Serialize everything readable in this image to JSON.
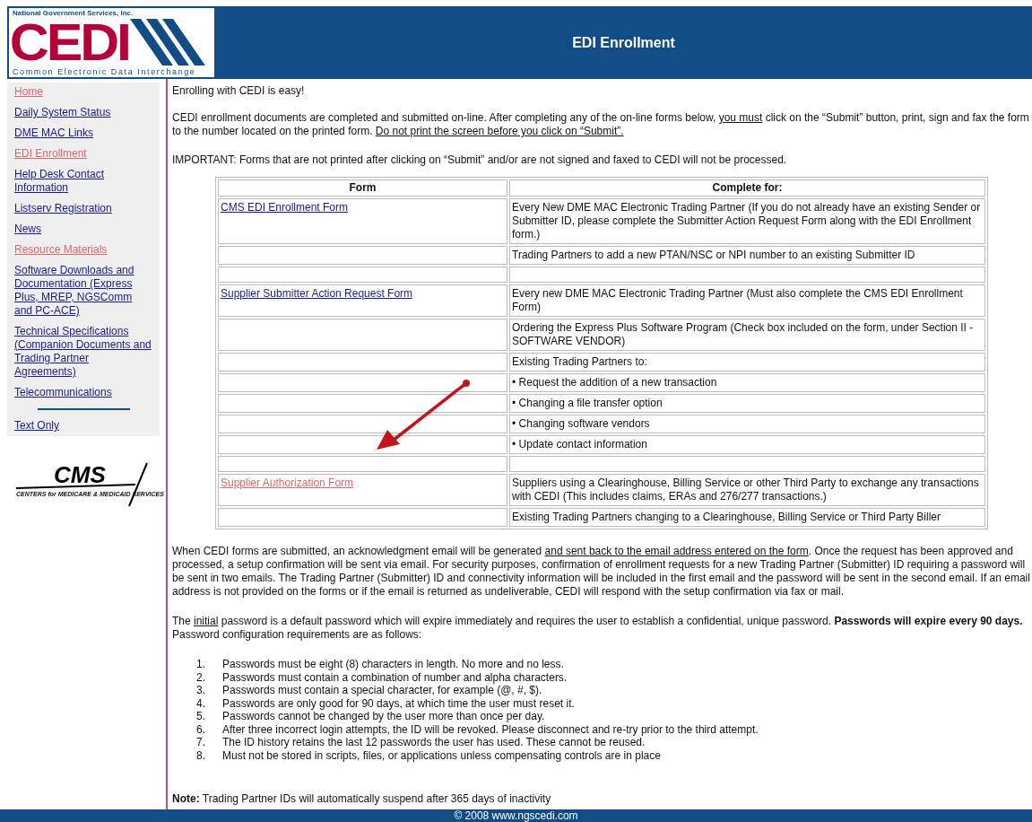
{
  "header": {
    "logo": {
      "org": "National Government Services, Inc.",
      "mark": "CEDI",
      "tagline": "Common Electronic Data Interchange"
    },
    "title": "EDI Enrollment"
  },
  "sidebar": {
    "items": [
      {
        "label": "Home",
        "visited": true
      },
      {
        "label": "Daily System Status",
        "visited": false
      },
      {
        "label": "DME MAC Links",
        "visited": false
      },
      {
        "label": "EDI Enrollment",
        "visited": true
      },
      {
        "label": "Help Desk Contact Information",
        "visited": false
      },
      {
        "label": "Listserv Registration",
        "visited": false
      },
      {
        "label": "News",
        "visited": false
      },
      {
        "label": "Resource Materials",
        "visited": true
      },
      {
        "label": "Software Downloads and Documentation (Express Plus, MREP, NGSComm and PC-ACE)",
        "visited": false
      },
      {
        "label": "Technical Specifications (Companion Documents and Trading Partner Agreements)",
        "visited": false
      },
      {
        "label": "Telecommunications",
        "visited": false
      }
    ],
    "footer_link": {
      "label": "Text Only",
      "visited": false
    },
    "cms_logo": {
      "mark": "CMS",
      "tagline": "CENTERS for MEDICARE & MEDICAID SERVICES"
    }
  },
  "intro": "Enrolling with CEDI is easy!",
  "instructions": [
    {
      "text": "CEDI enrollment documents are completed and submitted on-line. After completing any of the on-line forms below, ",
      "underline": false
    },
    {
      "text": "you must",
      "underline": true
    },
    {
      "text": " click on the “Submit” button, print, sign and fax the form to the number located on the printed form. ",
      "underline": false
    },
    {
      "text": "Do not print the screen before you click on “Submit”.",
      "underline": true
    }
  ],
  "important": "IMPORTANT: Forms that are not printed after clicking on “Submit” and/or are not signed and faxed to CEDI will not be processed.",
  "table": {
    "columns": [
      "Form",
      "Complete for:"
    ],
    "rows": [
      {
        "form": {
          "label": "CMS EDI Enrollment Form",
          "visited": false
        },
        "complete_for": "Every New DME MAC Electronic Trading Partner (If you do not already have an existing Sender or Submitter ID, please complete the Submitter Action Request Form along with the EDI Enrollment form.)"
      },
      {
        "complete_for": "Trading Partners to add a new PTAN/NSC or NPI number to an existing Submitter ID"
      },
      {},
      {
        "form": {
          "label": "Supplier Submitter Action Request Form",
          "visited": false
        },
        "complete_for": "Every new DME MAC Electronic Trading Partner (Must also complete the CMS EDI Enrollment Form)"
      },
      {
        "complete_for": "Ordering the Express Plus Software Program (Check box included on the form, under Section II - SOFTWARE VENDOR)"
      },
      {
        "complete_for": "Existing Trading Partners to:"
      },
      {
        "complete_for": "• Request the addition of a new transaction"
      },
      {
        "complete_for": "• Changing a file transfer option"
      },
      {
        "complete_for": "• Changing software vendors"
      },
      {
        "complete_for": "• Update contact information"
      },
      {},
      {
        "form": {
          "label": "Supplier Authorization Form",
          "visited": true
        },
        "complete_for": "Suppliers using a Clearinghouse, Billing Service or other Third Party to exchange any transactions with CEDI (This includes claims, ERAs and 276/277 transactions.)"
      },
      {
        "complete_for": "Existing Trading Partners changing to a Clearinghouse, Billing Service or Third Party Biller"
      }
    ]
  },
  "acknowledgment": [
    {
      "text": "When CEDI forms are submitted, an acknowledgment email will be generated ",
      "underline": false
    },
    {
      "text": "and sent back to the email address entered on the form",
      "underline": true
    },
    {
      "text": ". Once the request has been approved and processed, a setup confirmation will be sent via email. For security purposes, confirmation of enrollment requests for a new Trading Partner (Submitter) ID requiring a password will be sent in two emails. The Trading Partner (Submitter) ID and connectivity information will be included in the first email and the password will be sent in the second email. If an email address is not provided on the forms or if the email is returned as undeliverable, CEDI will respond with the setup confirmation via fax or mail.",
      "underline": false
    }
  ],
  "password_intro": [
    {
      "text": "The ",
      "underline": false
    },
    {
      "text": "initial",
      "underline": true
    },
    {
      "text": " password is a default password which will expire immediately and requires the user to establish a confidential, unique password. **Passwords will expire every 90 days.** Password configuration requirements are as follows:",
      "underline": false
    }
  ],
  "requirements": [
    {
      "number": "1.",
      "text": "Passwords must be eight (8) characters in length. No more and no less."
    },
    {
      "number": "2.",
      "text": "Passwords must contain a combination of number and alpha characters."
    },
    {
      "number": "3.",
      "text": "Passwords must contain a special character, for example (@, #, $)."
    },
    {
      "number": "4.",
      "text": "Passwords are only good for 90 days, at which time the user must reset it."
    },
    {
      "number": "5.",
      "text": "Passwords cannot be changed by the user more than once per day."
    },
    {
      "number": "6.",
      "text": "After three incorrect login attempts, the ID will be revoked. Please disconnect and re-try prior to the third attempt."
    },
    {
      "number": "7.",
      "text": "The ID history retains the last 12 passwords the user has used. These cannot be reused."
    },
    {
      "number": "8.",
      "text": "Must not be stored in scripts, files, or applications unless compensating controls are in place"
    }
  ],
  "note": "**Note:** Trading Partner IDs will automatically suspend after 365 days of inactivity",
  "footer": "© 2008 www.ngscedi.com"
}
